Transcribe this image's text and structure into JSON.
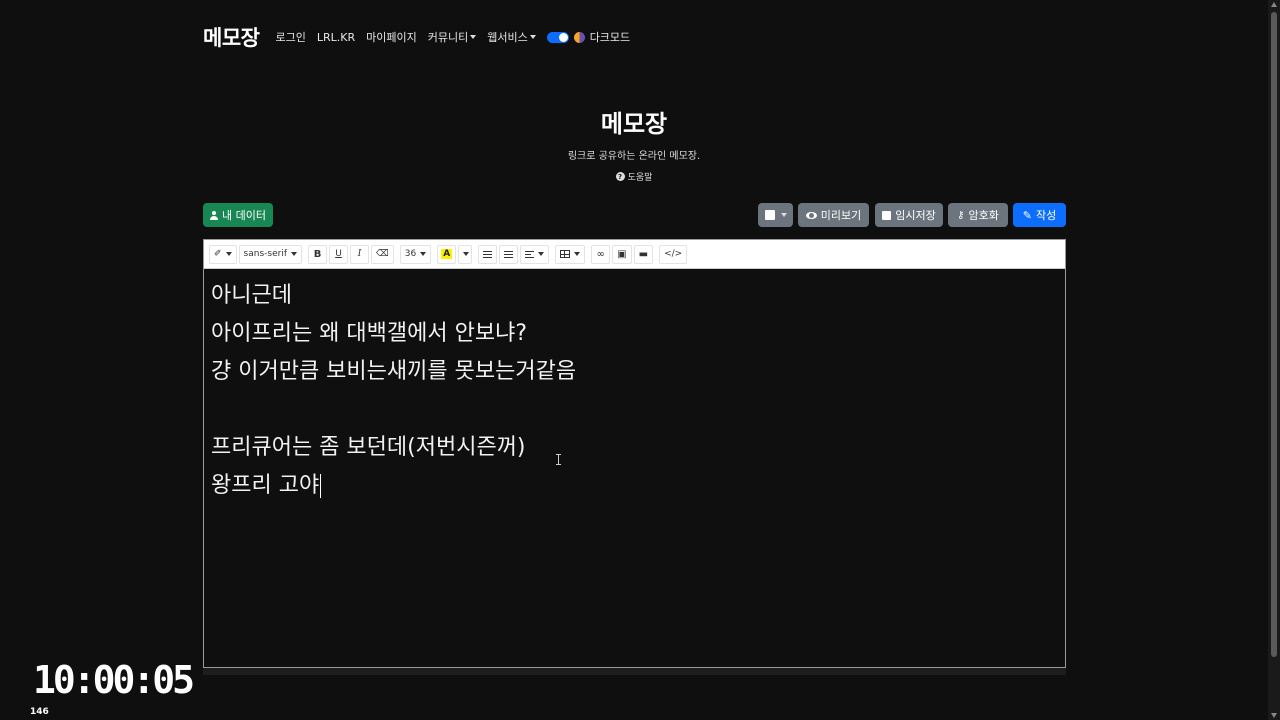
{
  "nav": {
    "brand": "메모장",
    "links": [
      "로그인",
      "LRL.KR",
      "마이페이지"
    ],
    "dropdowns": [
      "커뮤니티",
      "웹서비스"
    ],
    "dark_mode_label": "다크모드",
    "dark_mode_on": true
  },
  "hero": {
    "title": "메모장",
    "subtitle": "링크로 공유하는 온라인 메모장.",
    "help": "도움말"
  },
  "actions": {
    "my_data": "내 데이터",
    "preview": "미리보기",
    "temp_save": "임시저장",
    "encrypt": "암호화",
    "write": "작성"
  },
  "toolbar": {
    "font_family": "sans-serif",
    "bold": "B",
    "underline": "U",
    "italic": "I",
    "font_size": "36",
    "color_letter": "A",
    "code": "</>"
  },
  "editor": {
    "lines": [
      "아니근데",
      "아이프리는 왜 대백갤에서 안보냐?",
      "걍 이거만큼 보비는새끼를 못보는거같음",
      "",
      "프리큐어는 좀 보던데(저번시즌꺼)",
      "왕프리 고야"
    ]
  },
  "overlay": {
    "clock": "10:00:05",
    "counter": "146"
  },
  "colors": {
    "background": "#0f0f10",
    "green": "#198754",
    "gray": "#6c757d",
    "blue": "#0d6efd"
  }
}
